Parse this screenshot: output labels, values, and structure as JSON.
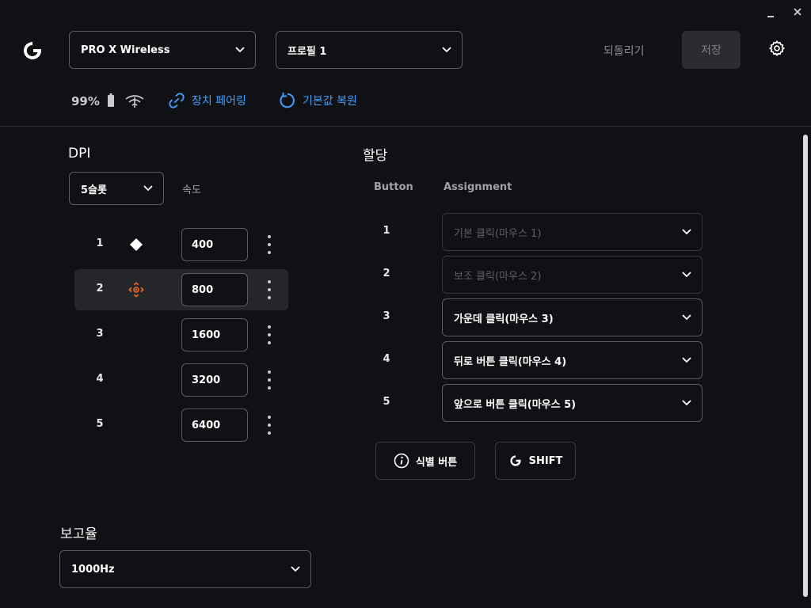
{
  "window": {
    "minimize_icon": "minimize-icon",
    "close_icon": "close-icon"
  },
  "header": {
    "logo": "logitech-g-logo",
    "device_select": {
      "value": "PRO X Wireless"
    },
    "profile_select": {
      "value": "프로필 1"
    },
    "revert_label": "되돌리기",
    "save_label": "저장",
    "settings_icon": "gear-icon"
  },
  "status": {
    "battery": "99%",
    "pair_label": "장치 페어링",
    "restore_label": "기본값 복원"
  },
  "dpi": {
    "title": "DPI",
    "slots_select": "5슬롯",
    "speed_label": "속도",
    "active_slot": 2,
    "default_slot": 1,
    "slots": [
      {
        "num": "1",
        "value": "400"
      },
      {
        "num": "2",
        "value": "800"
      },
      {
        "num": "3",
        "value": "1600"
      },
      {
        "num": "4",
        "value": "3200"
      },
      {
        "num": "5",
        "value": "6400"
      }
    ]
  },
  "report_rate": {
    "title": "보고율",
    "value": "1000Hz"
  },
  "assignment": {
    "title": "할당",
    "col_button": "Button",
    "col_assignment": "Assignment",
    "rows": [
      {
        "num": "1",
        "value": "기본 클릭(마우스 1)",
        "disabled": true
      },
      {
        "num": "2",
        "value": "보조 클릭(마우스 2)",
        "disabled": true
      },
      {
        "num": "3",
        "value": "가운데 클릭(마우스 3)",
        "disabled": false
      },
      {
        "num": "4",
        "value": "뒤로 버튼 클릭(마우스 4)",
        "disabled": false
      },
      {
        "num": "5",
        "value": "앞으로 버튼 클릭(마우스 5)",
        "disabled": false
      }
    ],
    "identify_label": "식별 버튼",
    "shift_label": "SHIFT"
  },
  "colors": {
    "accent": "#3ea0ff",
    "dpi_marker": "#ff6a1a",
    "background": "#101114"
  }
}
